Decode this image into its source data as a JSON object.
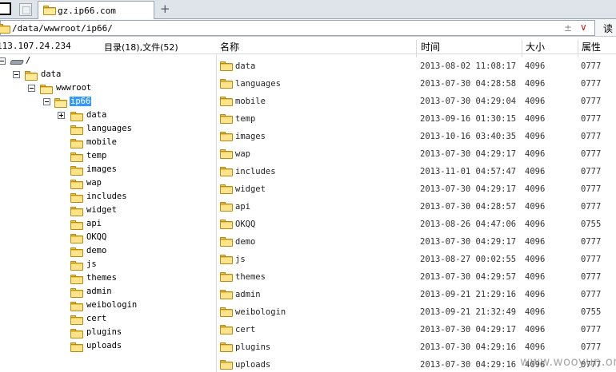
{
  "tabs": [
    {
      "label": "gz.ip66.com",
      "active": true
    }
  ],
  "address": {
    "path": "/data/wwwroot/ip66/",
    "plusminus": "±",
    "chevron": "∨",
    "read_label": "读"
  },
  "info": {
    "ip": "113.107.24.234",
    "counts": "目录(18),文件(52)"
  },
  "columns": {
    "name": "名称",
    "time": "时间",
    "size": "大小",
    "attr": "属性"
  },
  "tree": {
    "root": "/",
    "data": "data",
    "wwwroot": "wwwroot",
    "selected": "ip66",
    "children": [
      "data",
      "languages",
      "mobile",
      "temp",
      "images",
      "wap",
      "includes",
      "widget",
      "api",
      "OKQQ",
      "demo",
      "js",
      "themes",
      "admin",
      "weibologin",
      "cert",
      "plugins",
      "uploads"
    ]
  },
  "files": [
    {
      "name": "data",
      "time": "2013-08-02 11:08:17",
      "size": "4096",
      "attr": "0777"
    },
    {
      "name": "languages",
      "time": "2013-07-30 04:28:58",
      "size": "4096",
      "attr": "0777"
    },
    {
      "name": "mobile",
      "time": "2013-07-30 04:29:04",
      "size": "4096",
      "attr": "0777"
    },
    {
      "name": "temp",
      "time": "2013-09-16 01:30:15",
      "size": "4096",
      "attr": "0777"
    },
    {
      "name": "images",
      "time": "2013-10-16 03:40:35",
      "size": "4096",
      "attr": "0777"
    },
    {
      "name": "wap",
      "time": "2013-07-30 04:29:17",
      "size": "4096",
      "attr": "0777"
    },
    {
      "name": "includes",
      "time": "2013-11-01 04:57:47",
      "size": "4096",
      "attr": "0777"
    },
    {
      "name": "widget",
      "time": "2013-07-30 04:29:17",
      "size": "4096",
      "attr": "0777"
    },
    {
      "name": "api",
      "time": "2013-07-30 04:28:57",
      "size": "4096",
      "attr": "0777"
    },
    {
      "name": "OKQQ",
      "time": "2013-08-26 04:47:06",
      "size": "4096",
      "attr": "0755"
    },
    {
      "name": "demo",
      "time": "2013-07-30 04:29:17",
      "size": "4096",
      "attr": "0777"
    },
    {
      "name": "js",
      "time": "2013-08-27 00:02:55",
      "size": "4096",
      "attr": "0777"
    },
    {
      "name": "themes",
      "time": "2013-07-30 04:29:57",
      "size": "4096",
      "attr": "0777"
    },
    {
      "name": "admin",
      "time": "2013-09-21 21:29:16",
      "size": "4096",
      "attr": "0777"
    },
    {
      "name": "weibologin",
      "time": "2013-09-21 21:32:49",
      "size": "4096",
      "attr": "0755"
    },
    {
      "name": "cert",
      "time": "2013-07-30 04:29:17",
      "size": "4096",
      "attr": "0777"
    },
    {
      "name": "plugins",
      "time": "2013-07-30 04:29:16",
      "size": "4096",
      "attr": "0777"
    },
    {
      "name": "uploads",
      "time": "2013-07-30 04:29:16",
      "size": "4096",
      "attr": "0777"
    }
  ],
  "watermark": "www.wooyun.org"
}
